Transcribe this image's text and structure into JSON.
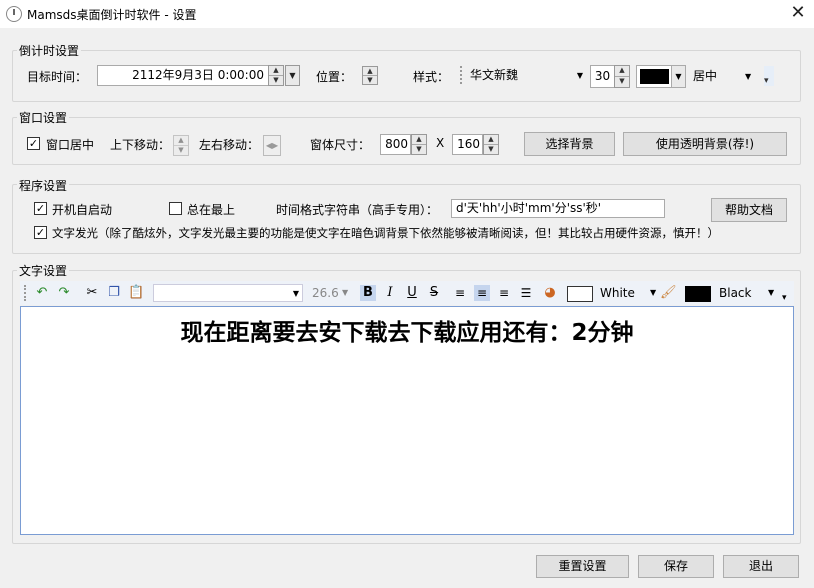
{
  "window": {
    "title": "Mamsds桌面倒计时软件 - 设置",
    "close_glyph": "✕"
  },
  "countdown_group": {
    "legend": "倒计时设置",
    "target_time_label": "目标时间：",
    "target_time_value": "2112年9月3日 0:00:00",
    "position_label": "位置：",
    "style_label": "样式：",
    "font_name": "华文新魏",
    "font_size": "30",
    "color": "#000000",
    "align": "居中"
  },
  "window_group": {
    "legend": "窗口设置",
    "center_label": "窗口居中",
    "center_checked": true,
    "vmove_label": "上下移动：",
    "hmove_label": "左右移动：",
    "size_label": "窗体尺寸：",
    "width": "800",
    "x_label": "X",
    "height": "160",
    "choose_bg_button": "选择背景",
    "transparent_bg_button": "使用透明背景(荐!)"
  },
  "program_group": {
    "legend": "程序设置",
    "autostart_label": "开机自启动",
    "autostart_checked": true,
    "ontop_label": "总在最上",
    "ontop_checked": false,
    "format_label": "时间格式字符串（高手专用）：",
    "format_value": "d'天'hh'小时'mm'分'ss'秒'",
    "help_button": "帮助文档",
    "glow_label": "文字发光（除了酷炫外，文字发光最主要的功能是使文字在暗色调背景下依然能够被清晰阅读，但！其比较占用硬件资源，慎开！）",
    "glow_checked": true
  },
  "text_group": {
    "legend": "文字设置",
    "toolbar": {
      "font_size": "26.6",
      "fore_color_name": "White",
      "fore_color": "#ffffff",
      "back_color_name": "Black",
      "back_color": "#000000"
    },
    "editor_text": "现在距离要去安下载去下载应用还有：2分钟"
  },
  "footer": {
    "reset_button": "重置设置",
    "save_button": "保存",
    "exit_button": "退出"
  }
}
